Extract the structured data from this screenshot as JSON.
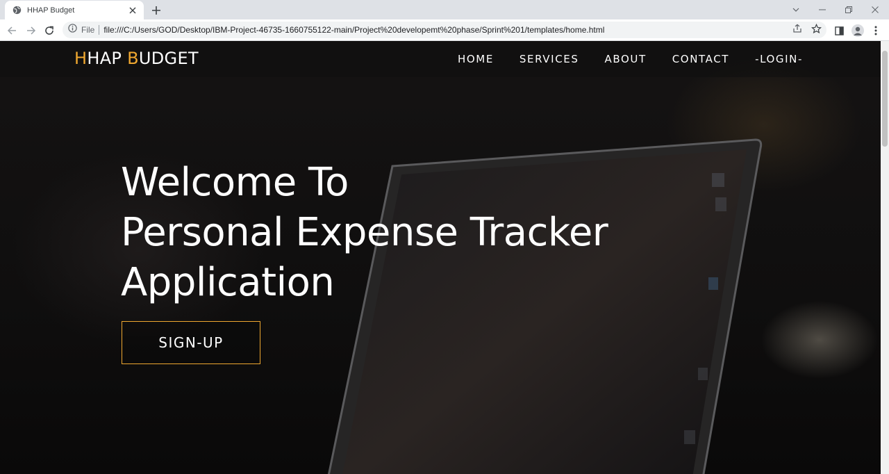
{
  "browser": {
    "tab": {
      "title": "HHAP Budget"
    },
    "address": {
      "scheme_label": "File",
      "url": "file:///C:/Users/GOD/Desktop/IBM-Project-46735-1660755122-main/Project%20developemt%20phase/Sprint%201/templates/home.html"
    }
  },
  "site": {
    "logo": {
      "h1": "H",
      "part1": "HAP ",
      "b": "B",
      "part2": "UDGET"
    },
    "nav": [
      {
        "label": "HOME"
      },
      {
        "label": "SERVICES"
      },
      {
        "label": "ABOUT"
      },
      {
        "label": "CONTACT"
      },
      {
        "label": "-LOGIN-"
      }
    ],
    "hero": {
      "lines": [
        "Welcome To",
        "Personal Expense Tracker",
        "Application"
      ],
      "cta": "SIGN-UP"
    },
    "colors": {
      "accent": "#f0a830",
      "text": "#ffffff"
    }
  }
}
